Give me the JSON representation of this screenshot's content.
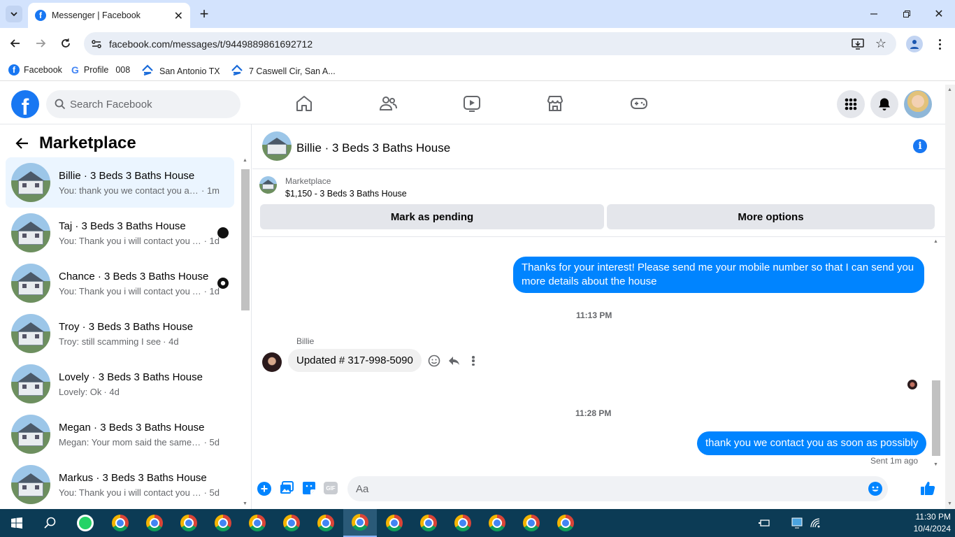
{
  "browser": {
    "tab_title": "Messenger | Facebook",
    "url": "facebook.com/messages/t/9449889861692712",
    "bookmarks": [
      "Facebook",
      "Profile",
      "008",
      "San Antonio TX",
      "7 Caswell Cir, San A..."
    ]
  },
  "fb": {
    "search_placeholder": "Search Facebook"
  },
  "sidebar": {
    "title": "Marketplace",
    "conversations": [
      {
        "name": "Billie · 3 Beds 3 Baths House",
        "preview": "You: thank you we contact you as soon as possibly",
        "time": "· 1m",
        "active": true
      },
      {
        "name": "Taj · 3 Beds 3 Baths House",
        "preview": "You: Thank you i will contact you As soon as possible",
        "time": "· 1d"
      },
      {
        "name": "Chance · 3 Beds 3 Baths House",
        "preview": "You: Thank you i will contact you As soon as possible",
        "time": "· 1d"
      },
      {
        "name": "Troy · 3 Beds 3 Baths House",
        "preview": "Troy: still scamming I see",
        "time": "· 4d"
      },
      {
        "name": "Lovely · 3 Beds 3 Baths House",
        "preview": "Lovely: Ok",
        "time": "· 4d"
      },
      {
        "name": "Megan · 3 Beds 3 Baths House",
        "preview": "Megan: Your mom said the same thing",
        "time": "· 5d"
      },
      {
        "name": "Markus · 3 Beds 3 Baths House",
        "preview": "You: Thank you i will contact you A...",
        "time": "· 5d"
      }
    ]
  },
  "chat": {
    "title": "Billie · 3 Beds 3 Baths House",
    "listing_label": "Marketplace",
    "listing_price": "$1,150 - 3 Beds 3 Baths House",
    "mark_pending": "Mark as pending",
    "more_options": "More options",
    "msg1": "Thanks for your interest! Please send me your mobile number so that I can send you more details about the house",
    "ts1": "11:13 PM",
    "sender": "Billie",
    "msg2": "Updated # 317-998-5090",
    "ts2": "11:28 PM",
    "msg3": "thank you we contact you as soon as possibly",
    "sent_status": "Sent 1m ago",
    "composer_placeholder": "Aa"
  },
  "taskbar": {
    "time": "11:30 PM",
    "date": "10/4/2024"
  },
  "colors": {
    "fb_blue": "#1877f2",
    "bubble_blue": "#0084ff",
    "tabstrip": "#d3e3fd",
    "taskbar": "#0c3b55"
  }
}
